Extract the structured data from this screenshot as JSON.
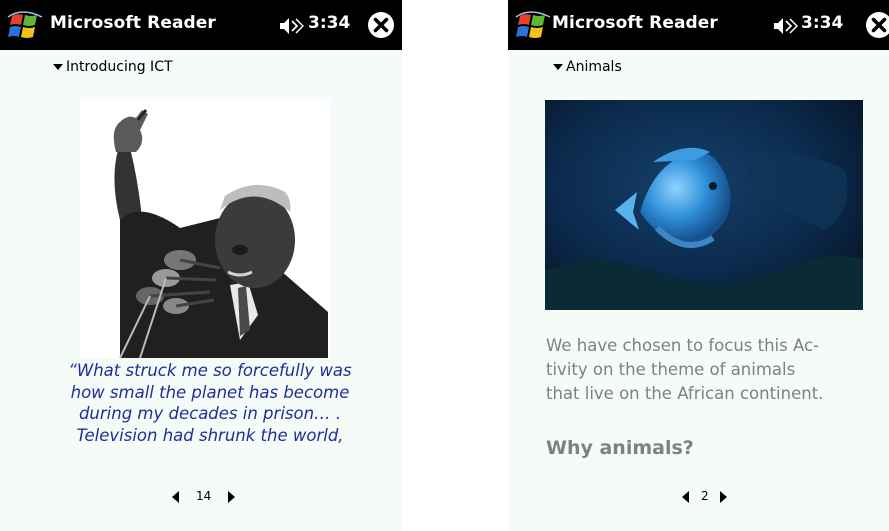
{
  "colors": {
    "titlebar_bg": "#000000",
    "page_bg": "#f5fbf6",
    "quote_text": "#1f2f9a",
    "body_text": "#808080"
  },
  "left_screen": {
    "titlebar": {
      "app_title": "Microsoft Reader",
      "time": "3:34",
      "icons": [
        "windows-start-icon",
        "speaker-icon",
        "close-icon"
      ]
    },
    "section_menu": "Introducing ICT",
    "image_subject": "man speaking at microphones with raised hand",
    "quote_lines": [
      "“What struck me so forcefully was",
      "how small the planet has become",
      "during my decades in prison… .",
      "Television had shrunk the world,"
    ],
    "page_number": "14"
  },
  "right_screen": {
    "titlebar": {
      "app_title": "Microsoft Reader",
      "time": "3:34",
      "icons": [
        "windows-start-icon",
        "speaker-icon",
        "close-icon"
      ]
    },
    "section_menu": "Animals",
    "image_subject": "blue fish swimming underwater",
    "body_lines": [
      "We have chosen to focus this Ac-",
      "tivity on the theme of animals",
      "that live on the African continent."
    ],
    "heading": "Why animals?",
    "page_number": "2"
  }
}
